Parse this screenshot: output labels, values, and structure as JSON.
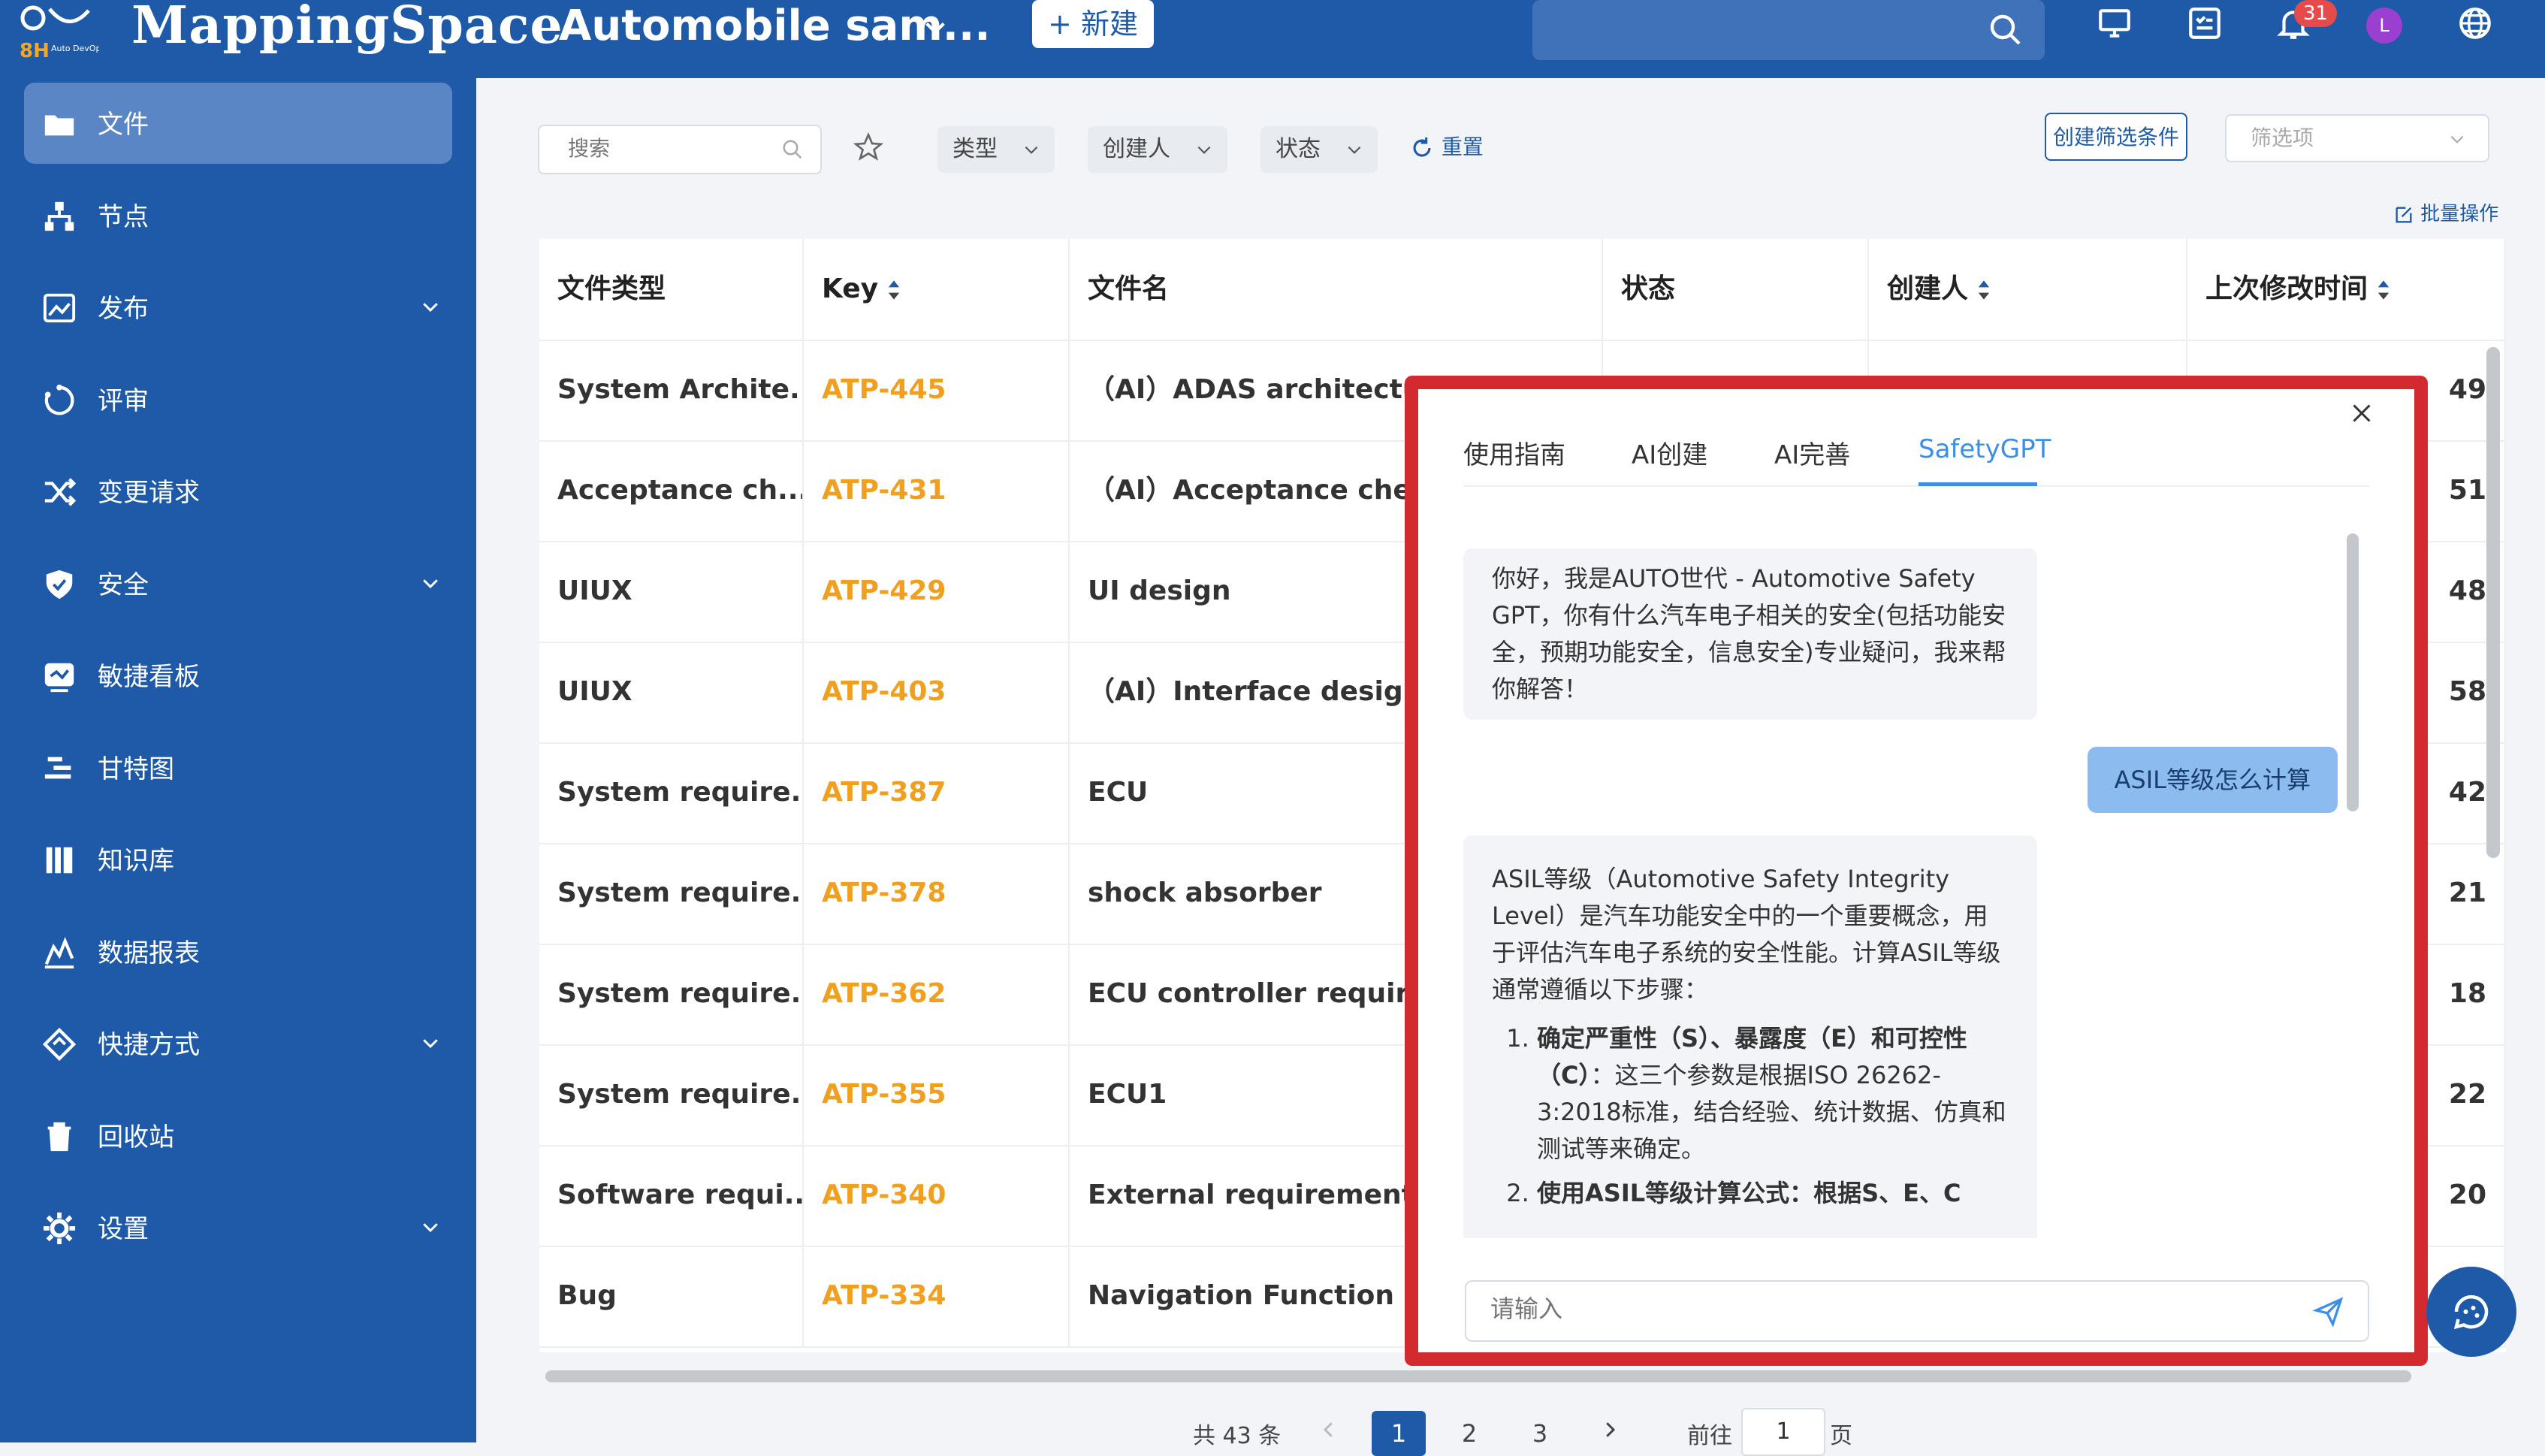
{
  "topbar": {
    "logo_text": "MappingSpace",
    "logo_badge": "8H",
    "logo_sub": "Auto DevOps",
    "project_title": "Automobile sam...",
    "new_button": "+ 新建",
    "notification_count": "31",
    "avatar_letter": "L"
  },
  "sidebar": {
    "items": [
      {
        "label": "文件",
        "icon": "folder-icon",
        "active": true
      },
      {
        "label": "节点",
        "icon": "node-tree-icon"
      },
      {
        "label": "发布",
        "icon": "publish-icon",
        "expandable": true
      },
      {
        "label": "评审",
        "icon": "review-icon"
      },
      {
        "label": "变更请求",
        "icon": "shuffle-icon"
      },
      {
        "label": "安全",
        "icon": "shield-icon",
        "expandable": true
      },
      {
        "label": "敏捷看板",
        "icon": "agile-board-icon"
      },
      {
        "label": "甘特图",
        "icon": "gantt-icon"
      },
      {
        "label": "知识库",
        "icon": "library-icon"
      },
      {
        "label": "数据报表",
        "icon": "chart-icon"
      },
      {
        "label": "快捷方式",
        "icon": "shortcut-icon",
        "expandable": true
      },
      {
        "label": "回收站",
        "icon": "trash-icon"
      },
      {
        "label": "设置",
        "icon": "gear-icon",
        "expandable": true
      }
    ]
  },
  "filters": {
    "search_placeholder": "搜索",
    "type": "类型",
    "creator": "创建人",
    "status": "状态",
    "reset": "重置",
    "create_filter": "创建筛选条件",
    "filter_select_placeholder": "筛选项",
    "batch": "批量操作"
  },
  "table": {
    "headers": [
      "文件类型",
      "Key",
      "文件名",
      "状态",
      "创建人",
      "上次修改时间"
    ],
    "rows": [
      {
        "type": "System Archite...",
        "key": "ATP-445",
        "name": "（AI）ADAS architecture",
        "time_tail": "49"
      },
      {
        "type": "Acceptance ch...",
        "key": "ATP-431",
        "name": "（AI）Acceptance check",
        "time_tail": "51"
      },
      {
        "type": "UIUX",
        "key": "ATP-429",
        "name": "UI design",
        "time_tail": "48"
      },
      {
        "type": "UIUX",
        "key": "ATP-403",
        "name": "（AI）Interface design",
        "time_tail": "58"
      },
      {
        "type": "System require...",
        "key": "ATP-387",
        "name": "ECU",
        "time_tail": "42"
      },
      {
        "type": "System require...",
        "key": "ATP-378",
        "name": "shock absorber",
        "time_tail": "21"
      },
      {
        "type": "System require...",
        "key": "ATP-362",
        "name": "ECU controller requirem",
        "time_tail": "18"
      },
      {
        "type": "System require...",
        "key": "ATP-355",
        "name": "ECU1",
        "time_tail": "22"
      },
      {
        "type": "Software requi...",
        "key": "ATP-340",
        "name": "External requirements g",
        "time_tail": "20"
      },
      {
        "type": "Bug",
        "key": "ATP-334",
        "name": "Navigation Function not",
        "time_tail": ""
      }
    ]
  },
  "pagination": {
    "total": "共 43 条",
    "pages": [
      "1",
      "2",
      "3"
    ],
    "goto_label": "前往",
    "goto_value": "1",
    "unit": "页"
  },
  "chat": {
    "tabs": [
      "使用指南",
      "AI创建",
      "AI完善",
      "SafetyGPT"
    ],
    "active_tab": "SafetyGPT",
    "greeting": "你好，我是AUTO世代 - Automotive Safety GPT，你有什么汽车电子相关的安全(包括功能安全，预期功能安全，信息安全)专业疑问，我来帮你解答！",
    "user_message": "ASIL等级怎么计算",
    "answer_intro": "ASIL等级（Automotive Safety Integrity Level）是汽车功能安全中的一个重要概念，用于评估汽车电子系统的安全性能。计算ASIL等级通常遵循以下步骤：",
    "step1_title": "确定严重性（S）、暴露度（E）和可控性（C）",
    "step1_text": "：这三个参数是根据ISO 26262-3:2018标准，结合经验、统计数据、仿真和测试等来确定。",
    "step2_partial": "使用ASIL等级计算公式：根据S、E、C",
    "input_placeholder": "请输入"
  },
  "colors": {
    "primary": "#1e5aa8",
    "accent_orange": "#f0a020",
    "highlight_red": "#d32a2f",
    "tab_blue": "#3c8fe6"
  }
}
